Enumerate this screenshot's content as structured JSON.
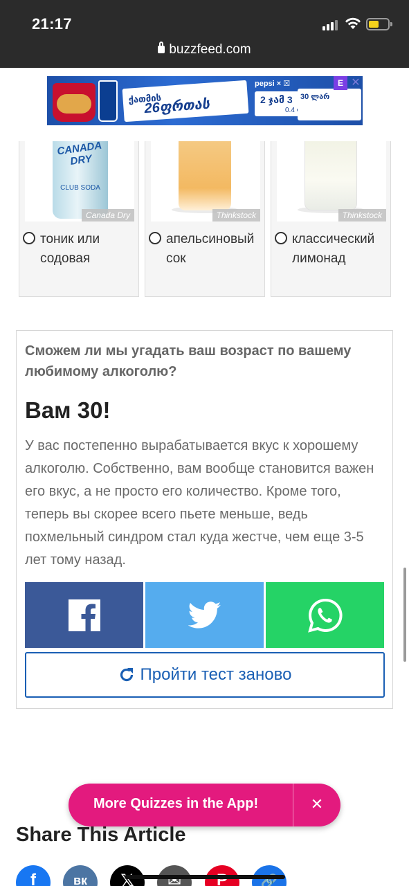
{
  "status_bar": {
    "time": "21:17",
    "url": "buzzfeed.com"
  },
  "ad": {
    "card_top": "ქათმის",
    "card_big": "26ფრთას",
    "logo_row": "pepsi × ☒",
    "price_top": "2 ჯამ 3",
    "price_sub": "0.4 ლ",
    "card2_text": "30 ლარ",
    "adchoice": "E",
    "close": "✕"
  },
  "answers": [
    {
      "label": "тоник или содовая",
      "credit": "Canada Dry",
      "can_brand": "CANADA DRY",
      "can_soda": "CLUB SODA"
    },
    {
      "label": "апельсиновый сок",
      "credit": "Thinkstock"
    },
    {
      "label": "классический лимонад",
      "credit": "Thinkstock"
    }
  ],
  "result": {
    "quiz_title": "Сможем ли мы угадать ваш возраст по вашему любимому алкоголю?",
    "heading": "Вам 30!",
    "text": "У вас постепенно вырабатывается вкус к хорошему алкоголю. Собственно, вам вообще становится важен его вкус, а не просто его количество. Кроме того, теперь вы скорее всего пьете меньше, ведь похмельный синдром стал куда жестче, чем еще 3-5 лет тому назад.",
    "retake_label": "Пройти тест заново"
  },
  "promo": {
    "label": "More Quizzes in the App!",
    "close": "✕"
  },
  "share_article": {
    "heading": "Share This Article",
    "buttons": [
      {
        "icon": "facebook-icon",
        "glyph": "f",
        "color": "#1877f2"
      },
      {
        "icon": "vk-icon",
        "glyph": "вк",
        "color": "#4c75a3"
      },
      {
        "icon": "x-icon",
        "glyph": "𝕏",
        "color": "#000000"
      },
      {
        "icon": "email-icon",
        "glyph": "✉",
        "color": "#555555"
      },
      {
        "icon": "pinterest-icon",
        "glyph": "P",
        "color": "#e60023"
      },
      {
        "icon": "copy-link-icon",
        "glyph": "🔗",
        "color": "#1a73e8"
      }
    ]
  },
  "colors": {
    "facebook": "#3b5998",
    "twitter": "#55acee",
    "whatsapp": "#25d366",
    "retake": "#1a5fb4",
    "promo": "#e31a7e"
  }
}
